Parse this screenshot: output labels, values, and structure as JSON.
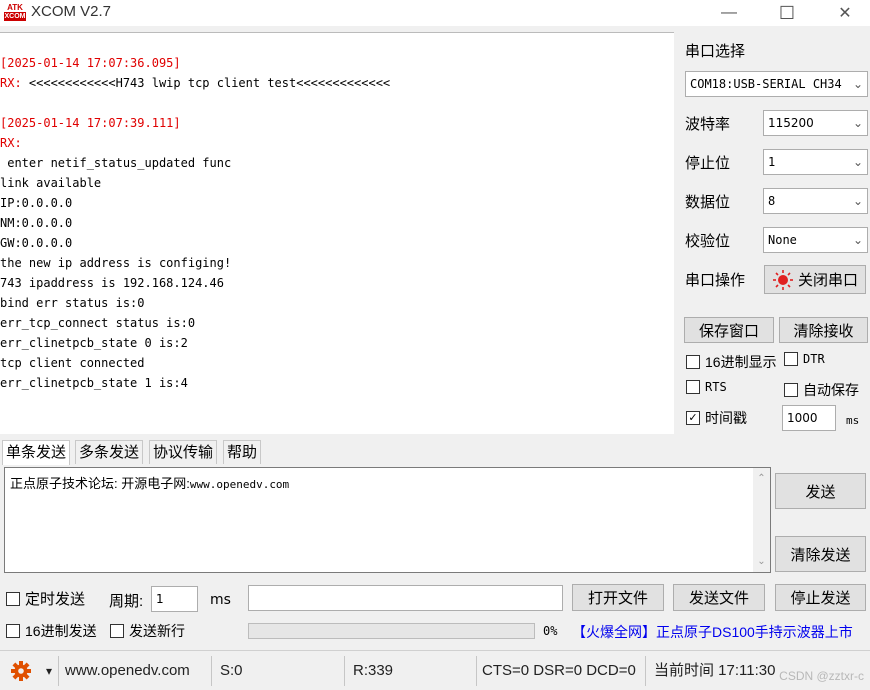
{
  "app": {
    "logo_top": "ATK",
    "logo_bottom": "XCOM",
    "title": "XCOM V2.7",
    "minimize": "—",
    "maximize": "☐",
    "close": "✕"
  },
  "receive": {
    "lines": [
      {
        "text": "",
        "color": "black"
      },
      {
        "text": "[2025-01-14 17:07:36.095]",
        "color": "red"
      },
      {
        "text": "RX: <<<<<<<<<<<<H743 lwip tcp client test<<<<<<<<<<<<<",
        "color": "mixed"
      },
      {
        "text": "",
        "color": "black"
      },
      {
        "text": "[2025-01-14 17:07:39.111]",
        "color": "red"
      },
      {
        "text": "RX:",
        "color": "red"
      },
      {
        "text": " enter netif_status_updated func",
        "color": "black"
      },
      {
        "text": "link available",
        "color": "black"
      },
      {
        "text": "IP:0.0.0.0",
        "color": "black"
      },
      {
        "text": "NM:0.0.0.0",
        "color": "black"
      },
      {
        "text": "GW:0.0.0.0",
        "color": "black"
      },
      {
        "text": "the new ip address is configing!",
        "color": "black"
      },
      {
        "text": "743 ipaddress is 192.168.124.46",
        "color": "black"
      },
      {
        "text": "bind err status is:0",
        "color": "black"
      },
      {
        "text": "err_tcp_connect status is:0",
        "color": "black"
      },
      {
        "text": "err_clinetpcb_state 0 is:2",
        "color": "black"
      },
      {
        "text": "tcp client connected",
        "color": "black"
      },
      {
        "text": "err_clinetpcb_state 1 is:4",
        "color": "black"
      }
    ],
    "rx_prefix": "RX: ",
    "rx_rest": "<<<<<<<<<<<<H743 lwip tcp client test<<<<<<<<<<<<<"
  },
  "panel": {
    "port_label": "串口选择",
    "port_value": "COM18:USB-SERIAL CH34",
    "baud_label": "波特率",
    "baud_value": "115200",
    "stop_label": "停止位",
    "stop_value": "1",
    "data_label": "数据位",
    "data_value": "8",
    "parity_label": "校验位",
    "parity_value": "None",
    "op_label": "串口操作",
    "close_port_button": "关闭串口",
    "save_window_button": "保存窗口",
    "clear_receive_button": "清除接收",
    "hex_display": {
      "label": "16进制显示",
      "checked": false
    },
    "dtr": {
      "label": "DTR",
      "checked": false
    },
    "rts": {
      "label": "RTS",
      "checked": false
    },
    "auto_save": {
      "label": "自动保存",
      "checked": false
    },
    "timestamp": {
      "label": "时间戳",
      "checked": true
    },
    "timestamp_value": "1000",
    "timestamp_unit": "ms"
  },
  "tabs": [
    "单条发送",
    "多条发送",
    "协议传输",
    "帮助"
  ],
  "send": {
    "text_prefix": "正点原子技术论坛: 开源电子网:",
    "text_url": "www.openedv.com",
    "send_button": "发送",
    "clear_send_button": "清除发送",
    "timed_send": {
      "label": "定时发送",
      "checked": false
    },
    "period_label": "周期:",
    "period_value": "1",
    "period_unit": "ms",
    "open_file_button": "打开文件",
    "send_file_button": "发送文件",
    "stop_send_button": "停止发送",
    "hex_send": {
      "label": "16进制发送",
      "checked": false
    },
    "send_newline": {
      "label": "发送新行",
      "checked": false
    },
    "progress_percent": "0%",
    "progress_fraction": 0,
    "ad_text": "【火爆全网】正点原子DS100手持示波器上市"
  },
  "status": {
    "gear_menu": "▾",
    "website": "www.openedv.com",
    "sent": "S:0",
    "received": "R:339",
    "signals": "CTS=0 DSR=0 DCD=0",
    "clock": "当前时间 17:11:30",
    "watermark": "CSDN @zztxr-c"
  },
  "colors": {
    "red_text": "#e00000",
    "ad_blue": "#0000ee",
    "gear": "#e05000"
  }
}
